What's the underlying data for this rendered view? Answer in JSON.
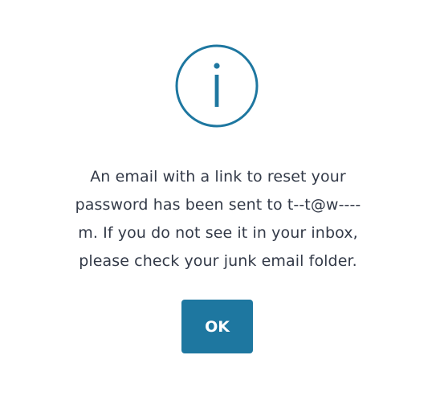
{
  "dialog": {
    "icon": "info-circle-icon",
    "accent_color": "#1e77a0",
    "message_lines": [
      "An email with a link to reset your",
      "password has been sent to t--t@w----",
      "m. If you do not see it in your inbox,",
      "please check your junk email folder."
    ],
    "ok_label": "OK"
  }
}
